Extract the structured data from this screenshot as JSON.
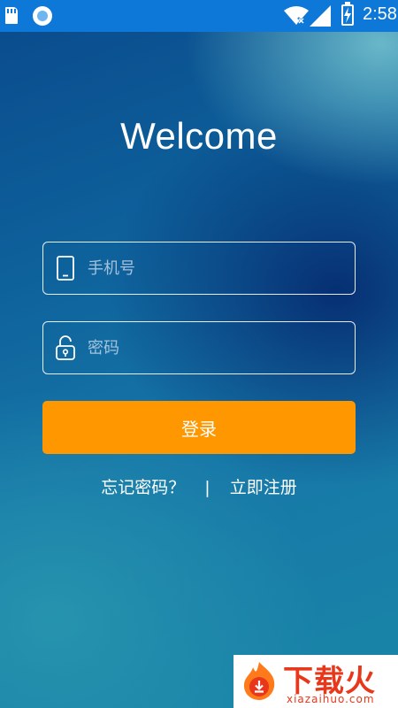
{
  "status_bar": {
    "time": "2:58",
    "icons": [
      "sd-card-icon",
      "circle-notification-icon",
      "wifi-icon",
      "signal-icon",
      "battery-charging-icon"
    ]
  },
  "title": "Welcome",
  "form": {
    "phone_placeholder": "手机号",
    "phone_value": "",
    "phone_icon": "phone-icon",
    "password_placeholder": "密码",
    "password_value": "",
    "password_icon": "unlock-icon",
    "login_label": "登录"
  },
  "links": {
    "forgot_password": "忘记密码？",
    "separator": "|",
    "register": "立即注册"
  },
  "watermark": {
    "title": "下载火",
    "url": "xiazaihuo.com"
  },
  "colors": {
    "status_bar": "#0e78d8",
    "login_button": "#ff9800",
    "watermark_red": "#e8371a"
  }
}
